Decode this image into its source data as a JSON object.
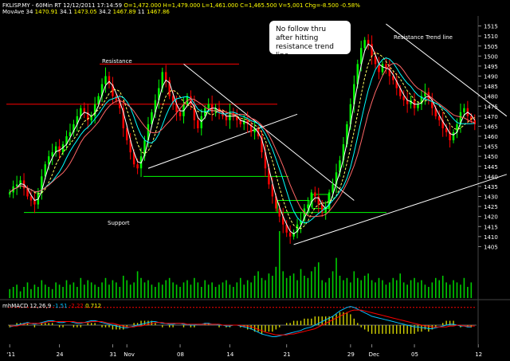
{
  "header": {
    "line1": [
      {
        "text": "FKLISP.MY - 60Min RT  12/12/2011  17:14:59",
        "color": "#ffffff"
      },
      {
        "text": "O=1,472.000",
        "color": "#ffff00"
      },
      {
        "text": "H=1,479.000",
        "color": "#ffff00"
      },
      {
        "text": "L=1,461.000",
        "color": "#ffff00"
      },
      {
        "text": "C=1,465.500",
        "color": "#ffff00"
      },
      {
        "text": "V=5,001",
        "color": "#ffff00"
      },
      {
        "text": "Chg=-8.500",
        "color": "#ffff00"
      },
      {
        "text": "-0.58%",
        "color": "#ffff00"
      }
    ],
    "line2": [
      {
        "text": "MovAve 34",
        "color": "#ffffff"
      },
      {
        "text": "1470.91",
        "color": "#ffff00"
      },
      {
        "text": "34.1",
        "color": "#ffffff"
      },
      {
        "text": "1473.05",
        "color": "#ffff00"
      },
      {
        "text": "34.2",
        "color": "#ffffff"
      },
      {
        "text": "1467.89",
        "color": "#ffff00"
      },
      {
        "text": "11",
        "color": "#ffffff"
      },
      {
        "text": "1467.86",
        "color": "#ffff00"
      }
    ]
  },
  "annotations": {
    "resistance": "Resistance",
    "support": "Support",
    "resistance_trendline": "Resistance Trend line",
    "callout": "No follow thru after hitting resistance trend line."
  },
  "macd_label": {
    "name": "mhMACD 12,26,9",
    "v1": "-1.51",
    "v2": "-2.22",
    "v3": "0.712"
  },
  "colors": {
    "background": "#000000",
    "candle_up": "#00ff00",
    "candle_down": "#ff0000",
    "volume": "#00cc00",
    "ma_fast": "#ffffff",
    "ma_mid": "#ffff66",
    "ma_slow": "#00ffff",
    "ma_slowest": "#ff6666",
    "resistance_line": "#ff0000",
    "support_line": "#00ff00",
    "trendline": "#ffffff",
    "macd_line": "#00bfff",
    "signal_line": "#ff0000",
    "histogram": "#d4d400",
    "axis_text": "#ffffff"
  },
  "chart_data": {
    "type": "candlestick",
    "interval": "60Min",
    "ylim": [
      1400,
      1520
    ],
    "yticks": [
      1405,
      1410,
      1415,
      1420,
      1425,
      1430,
      1435,
      1440,
      1445,
      1450,
      1455,
      1460,
      1465,
      1470,
      1475,
      1480,
      1485,
      1490,
      1495,
      1500,
      1505,
      1510,
      1515
    ],
    "xtick_labels": [
      "'11",
      "24",
      "31",
      "Nov",
      "08",
      "14",
      "21",
      "29",
      "Dec",
      "05",
      "12"
    ],
    "xtick_index": [
      0,
      14,
      29,
      33,
      48,
      62,
      78,
      96,
      102,
      114,
      132
    ],
    "levels": {
      "resistance_upper": 1496,
      "resistance_lower": 1476,
      "support_upper": 1440,
      "support_lower": 1422
    },
    "trendlines": [
      {
        "name": "falling",
        "from": [
          49,
          1496
        ],
        "to": [
          97,
          1428
        ]
      },
      {
        "name": "rising",
        "from": [
          39,
          1444
        ],
        "to": [
          81,
          1471
        ]
      },
      {
        "name": "rising-lower",
        "from": [
          80,
          1406
        ],
        "to": [
          140,
          1441
        ]
      },
      {
        "name": "resistance-trend",
        "from": [
          106,
          1516
        ],
        "to": [
          140,
          1470
        ]
      }
    ],
    "close": [
      1432,
      1435,
      1436,
      1438,
      1434,
      1430,
      1428,
      1426,
      1432,
      1440,
      1446,
      1450,
      1452,
      1455,
      1452,
      1456,
      1460,
      1462,
      1466,
      1470,
      1474,
      1472,
      1468,
      1470,
      1476,
      1480,
      1486,
      1490,
      1486,
      1480,
      1478,
      1474,
      1464,
      1458,
      1452,
      1446,
      1444,
      1450,
      1458,
      1466,
      1472,
      1478,
      1484,
      1492,
      1488,
      1480,
      1476,
      1472,
      1470,
      1476,
      1480,
      1476,
      1468,
      1464,
      1470,
      1474,
      1476,
      1472,
      1474,
      1472,
      1470,
      1468,
      1472,
      1470,
      1468,
      1466,
      1468,
      1466,
      1462,
      1464,
      1460,
      1452,
      1444,
      1436,
      1430,
      1424,
      1420,
      1416,
      1412,
      1410,
      1412,
      1416,
      1418,
      1424,
      1426,
      1432,
      1430,
      1426,
      1422,
      1424,
      1432,
      1436,
      1442,
      1448,
      1456,
      1466,
      1476,
      1486,
      1496,
      1504,
      1508,
      1506,
      1500,
      1496,
      1492,
      1496,
      1494,
      1490,
      1488,
      1484,
      1480,
      1478,
      1476,
      1478,
      1474,
      1476,
      1480,
      1482,
      1478,
      1474,
      1470,
      1468,
      1464,
      1462,
      1458,
      1462,
      1466,
      1472,
      1474,
      1470,
      1468,
      1466
    ],
    "volume": [
      4,
      5,
      6,
      3,
      5,
      7,
      4,
      6,
      5,
      8,
      6,
      5,
      4,
      7,
      6,
      5,
      8,
      6,
      7,
      5,
      9,
      6,
      8,
      7,
      6,
      5,
      7,
      9,
      6,
      8,
      7,
      5,
      10,
      8,
      6,
      7,
      12,
      9,
      7,
      8,
      6,
      5,
      7,
      6,
      8,
      9,
      7,
      6,
      5,
      7,
      8,
      6,
      9,
      7,
      5,
      8,
      6,
      7,
      5,
      6,
      7,
      8,
      6,
      5,
      7,
      9,
      6,
      8,
      7,
      10,
      12,
      9,
      8,
      11,
      10,
      14,
      30,
      12,
      9,
      10,
      11,
      8,
      13,
      10,
      9,
      12,
      14,
      16,
      8,
      7,
      9,
      12,
      18,
      10,
      8,
      9,
      7,
      12,
      9,
      8,
      10,
      11,
      8,
      7,
      9,
      8,
      6,
      7,
      9,
      8,
      11,
      7,
      6,
      8,
      9,
      7,
      8,
      6,
      5,
      7,
      9,
      8,
      10,
      7,
      6,
      8,
      7,
      6,
      9,
      5,
      7
    ],
    "macd": [
      -2,
      -1,
      0,
      1,
      2,
      3,
      2,
      1,
      2,
      3,
      4,
      5,
      5,
      4,
      3,
      3,
      4,
      4,
      3,
      2,
      2,
      3,
      4,
      5,
      5,
      4,
      3,
      2,
      1,
      0,
      -1,
      -2,
      -3,
      -3,
      -2,
      -1,
      0,
      1,
      2,
      3,
      4,
      4,
      3,
      2,
      2,
      1,
      1,
      2,
      2,
      1,
      1,
      0,
      0,
      1,
      1,
      2,
      2,
      1,
      1,
      0,
      0,
      -1,
      -1,
      0,
      0,
      -1,
      -2,
      -3,
      -4,
      -6,
      -8,
      -10,
      -11,
      -12,
      -13,
      -13,
      -12,
      -11,
      -10,
      -9,
      -8,
      -7,
      -6,
      -4,
      -3,
      -2,
      0,
      2,
      4,
      6,
      8,
      10,
      13,
      16,
      18,
      20,
      21,
      20,
      18,
      16,
      14,
      12,
      10,
      9,
      8,
      7,
      6,
      5,
      4,
      3,
      2,
      1,
      0,
      -1,
      -2,
      -2,
      -3,
      -3,
      -4,
      -4,
      -3,
      -2,
      -1,
      0,
      1,
      1,
      0,
      -1,
      -1,
      -2,
      -2
    ],
    "signal": [
      -1,
      -1,
      -1,
      0,
      1,
      2,
      2,
      2,
      2,
      2,
      3,
      4,
      4,
      4,
      4,
      4,
      4,
      4,
      4,
      3,
      3,
      3,
      3,
      4,
      4,
      4,
      4,
      3,
      2,
      2,
      1,
      0,
      -1,
      -2,
      -2,
      -2,
      -1,
      -1,
      0,
      1,
      2,
      3,
      3,
      3,
      2,
      2,
      2,
      2,
      2,
      2,
      1,
      1,
      1,
      1,
      1,
      1,
      1,
      1,
      1,
      1,
      0,
      0,
      0,
      0,
      0,
      0,
      -1,
      -1,
      -2,
      -3,
      -5,
      -6,
      -8,
      -9,
      -10,
      -11,
      -11,
      -11,
      -11,
      -10,
      -10,
      -9,
      -8,
      -7,
      -6,
      -5,
      -4,
      -2,
      0,
      2,
      4,
      6,
      8,
      10,
      12,
      14,
      16,
      17,
      17,
      17,
      16,
      15,
      14,
      13,
      12,
      11,
      10,
      9,
      8,
      7,
      6,
      5,
      4,
      3,
      2,
      1,
      0,
      -1,
      -1,
      -2,
      -2,
      -2,
      -2,
      -2,
      -1,
      -1,
      0,
      0,
      -1,
      -1,
      -1,
      -1
    ]
  }
}
